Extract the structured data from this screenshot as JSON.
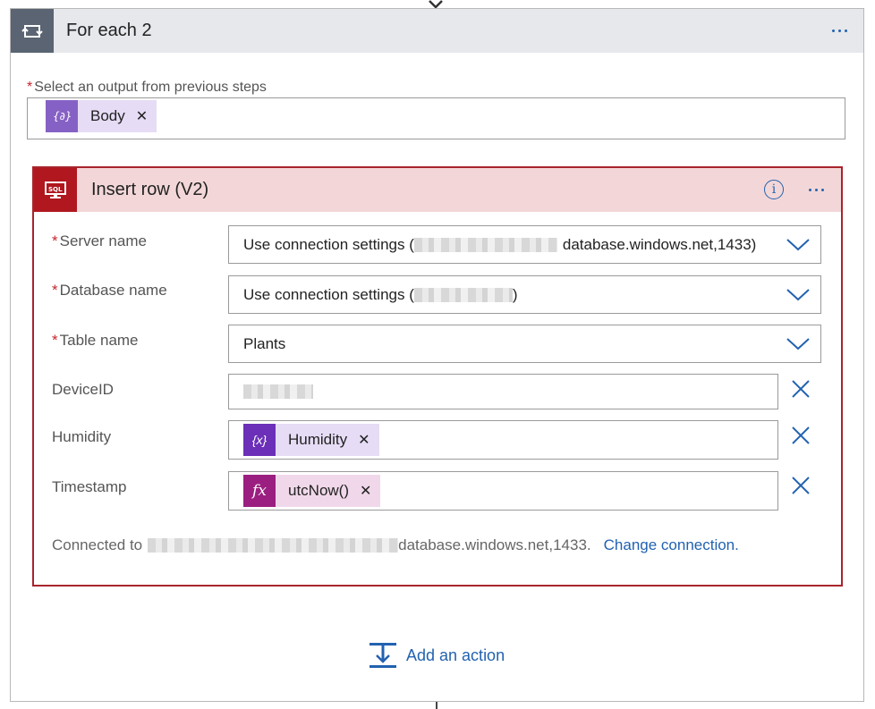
{
  "foreach": {
    "title": "For each 2",
    "output_label": "Select an output from previous steps",
    "output_token": {
      "label": "Body",
      "color": "#8661c5",
      "icon": "expression-braces-icon"
    }
  },
  "card": {
    "title": "Insert row (V2)",
    "accent_color": "#b0171f",
    "fields": {
      "server": {
        "label": "Server name",
        "value_prefix": "Use connection settings (",
        "value_suffix": "database.windows.net,1433)"
      },
      "database": {
        "label": "Database name",
        "value_prefix": "Use connection settings (",
        "value_suffix": ")"
      },
      "table": {
        "label": "Table name",
        "value": "Plants"
      },
      "deviceid": {
        "label": "DeviceID"
      },
      "humidity": {
        "label": "Humidity",
        "token": {
          "label": "Humidity",
          "color": "#6b2fb8",
          "icon": "{x}"
        }
      },
      "timestamp": {
        "label": "Timestamp",
        "token": {
          "label": "utcNow()",
          "color": "#9b1f80",
          "icon": "fx"
        }
      }
    },
    "connected": {
      "prefix": "Connected to",
      "suffix": "database.windows.net,1433.",
      "change_link": "Change connection."
    }
  },
  "add_action": {
    "label": "Add an action"
  },
  "colors": {
    "link": "#2262b0",
    "required": "#c4262e"
  }
}
